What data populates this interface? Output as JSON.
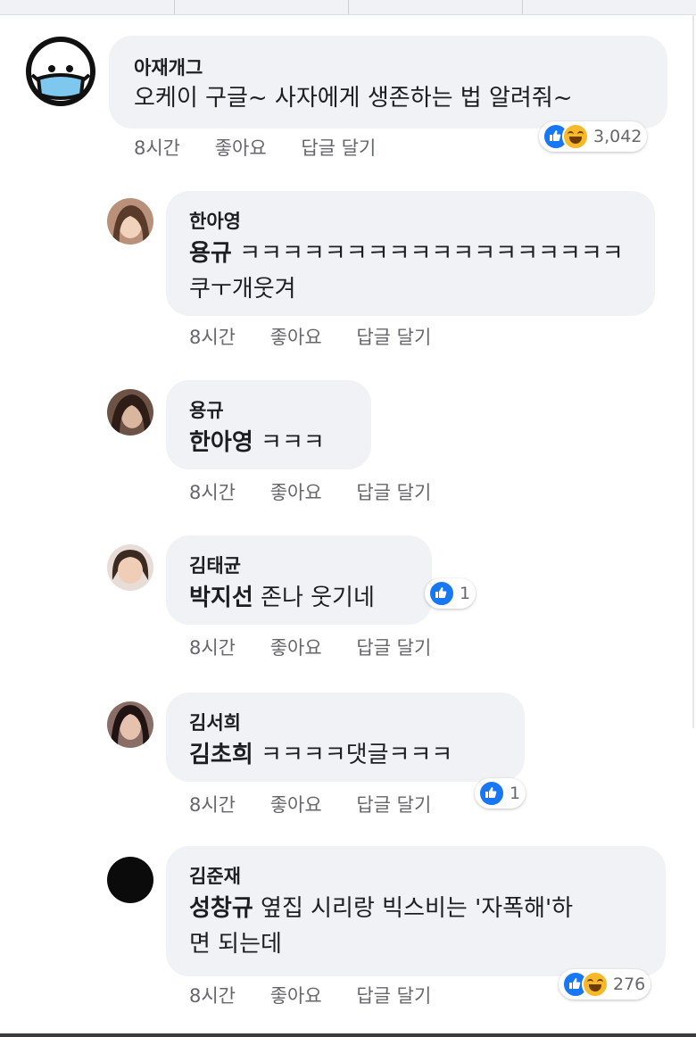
{
  "meta_labels": {
    "time": "8시간",
    "like": "좋아요",
    "reply": "답글 달기"
  },
  "colors": {
    "like_blue": "#1877f2",
    "haha_yellow": "#f7b928",
    "bubble_bg": "#f0f2f5"
  },
  "comments": [
    {
      "author": "아재개그",
      "text": "오케이 구글~ 사자에게 생존하는 법 알려줘~",
      "reactions": [
        "like-icon",
        "haha-icon"
      ],
      "reaction_count": "3,042"
    },
    {
      "author": "한아영",
      "mention": "용규",
      "text_line1": " ㅋㅋㅋㅋㅋㅋㅋㅋㅋㅋㅋㅋㅋㅋㅋㅋㅋㅋ",
      "text_line2": "쿠ㅜ개웃겨"
    },
    {
      "author": "용규",
      "mention": "한아영",
      "text": " ㅋㅋㅋ"
    },
    {
      "author": "김태균",
      "mention": "박지선",
      "text": " 존나 웃기네",
      "reactions": [
        "like-icon"
      ],
      "reaction_count": "1"
    },
    {
      "author": "김서희",
      "mention": "김초희",
      "text": " ㅋㅋㅋㅋ댓글ㅋㅋㅋ",
      "reactions": [
        "like-icon"
      ],
      "reaction_count": "1"
    },
    {
      "author": "김준재",
      "mention": "성창규",
      "text_line1": " 옆집 시리랑 빅스비는 '자폭해'하",
      "text_line2": "면 되는데",
      "reactions": [
        "like-icon",
        "haha-icon"
      ],
      "reaction_count": "276"
    }
  ]
}
